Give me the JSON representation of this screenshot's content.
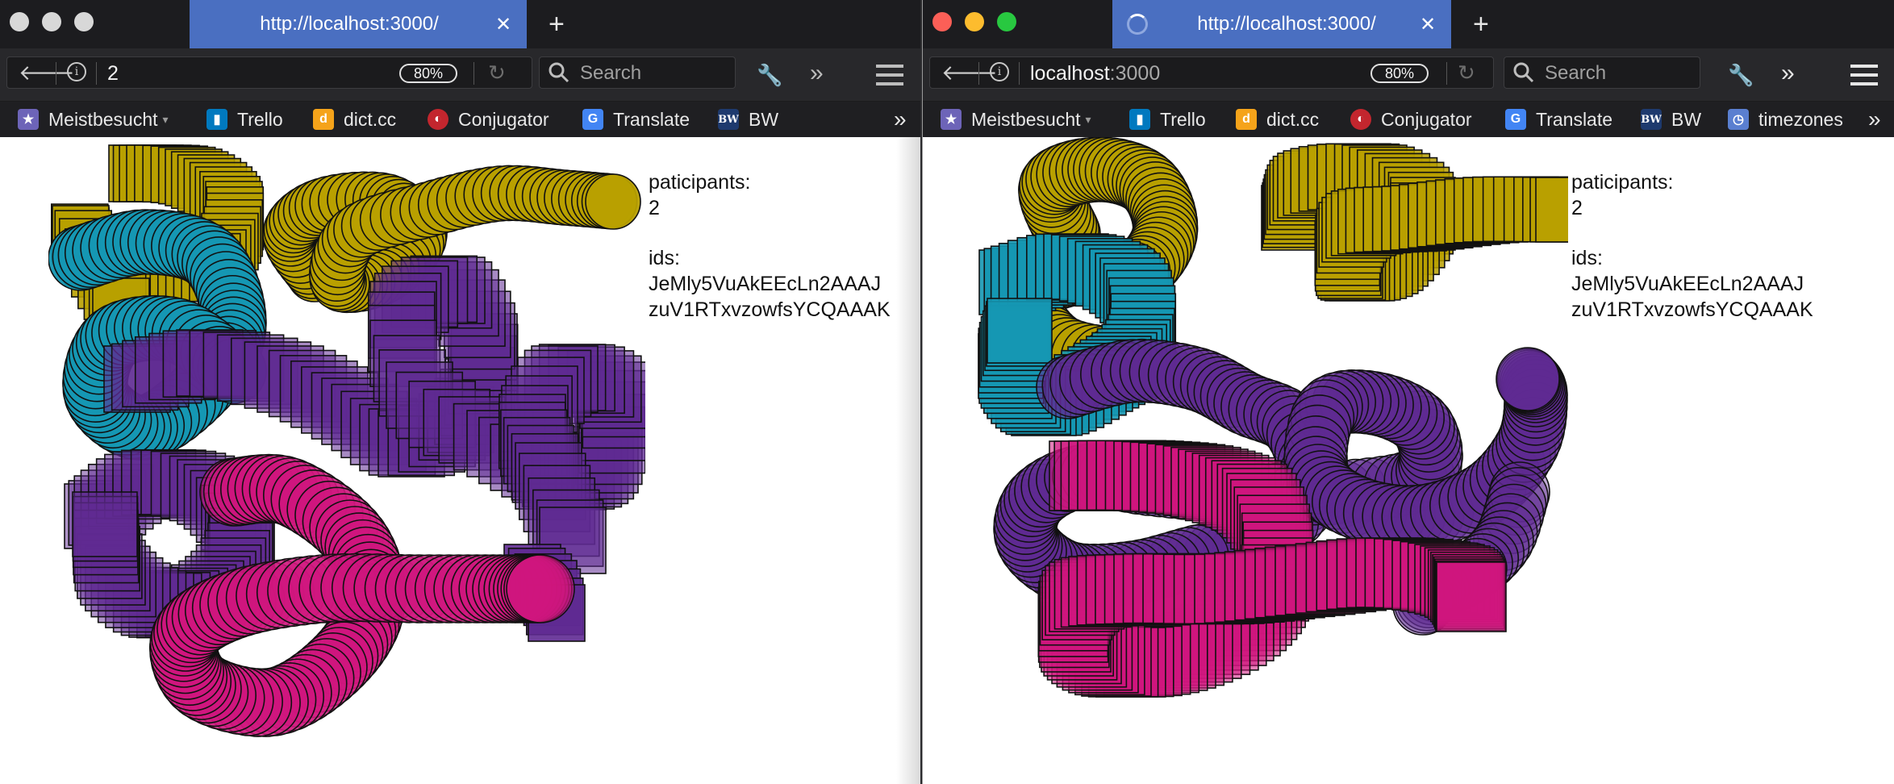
{
  "windows": [
    {
      "side": "left",
      "tab_title": "http://localhost:3000/",
      "url_text": "2",
      "zoom": "80%",
      "search_placeholder": "Search",
      "bookmarks": [
        {
          "label": "Meistbesucht",
          "icon": "folder-icon",
          "color": "#6d64b8"
        },
        {
          "label": "Trello",
          "icon": "trello-icon",
          "color": "#0079bf"
        },
        {
          "label": "dict.cc",
          "icon": "dictcc-icon",
          "color": "#f5a31a"
        },
        {
          "label": "Conjugator",
          "icon": "conjugator-icon",
          "color": "#c3262e"
        },
        {
          "label": "Translate",
          "icon": "translate-icon",
          "color": "#4285f4"
        },
        {
          "label": "BW",
          "icon": "bw-icon",
          "color": "#1e3a6e"
        }
      ],
      "panel": {
        "participants_label": "paticipants:",
        "participants_value": "2",
        "ids_label": "ids:",
        "ids": [
          "JeMly5VuAkEEcLn2AAAJ",
          "zuV1RTxvzowfsYCQAAAK"
        ]
      }
    },
    {
      "side": "right",
      "tab_title": "http://localhost:3000/",
      "url_host": "localhost",
      "url_port": ":3000",
      "zoom": "80%",
      "search_placeholder": "Search",
      "bookmarks": [
        {
          "label": "Meistbesucht",
          "icon": "folder-icon",
          "color": "#6d64b8"
        },
        {
          "label": "Trello",
          "icon": "trello-icon",
          "color": "#0079bf"
        },
        {
          "label": "dict.cc",
          "icon": "dictcc-icon",
          "color": "#f5a31a"
        },
        {
          "label": "Conjugator",
          "icon": "conjugator-icon",
          "color": "#c3262e"
        },
        {
          "label": "Translate",
          "icon": "translate-icon",
          "color": "#4285f4"
        },
        {
          "label": "BW",
          "icon": "bw-icon",
          "color": "#1e3a6e"
        },
        {
          "label": "timezones",
          "icon": "timezones-icon",
          "color": "#5a7fd0"
        }
      ],
      "panel": {
        "participants_label": "paticipants:",
        "participants_value": "2",
        "ids_label": "ids:",
        "ids": [
          "JeMly5VuAkEEcLn2AAAJ",
          "zuV1RTxvzowfsYCQAAAK"
        ]
      }
    }
  ],
  "colors": {
    "olive": "#b8a000",
    "teal": "#1597b3",
    "purple": "#5f2a92",
    "magenta": "#d0157e",
    "tab_active": "#4a6fc1"
  }
}
